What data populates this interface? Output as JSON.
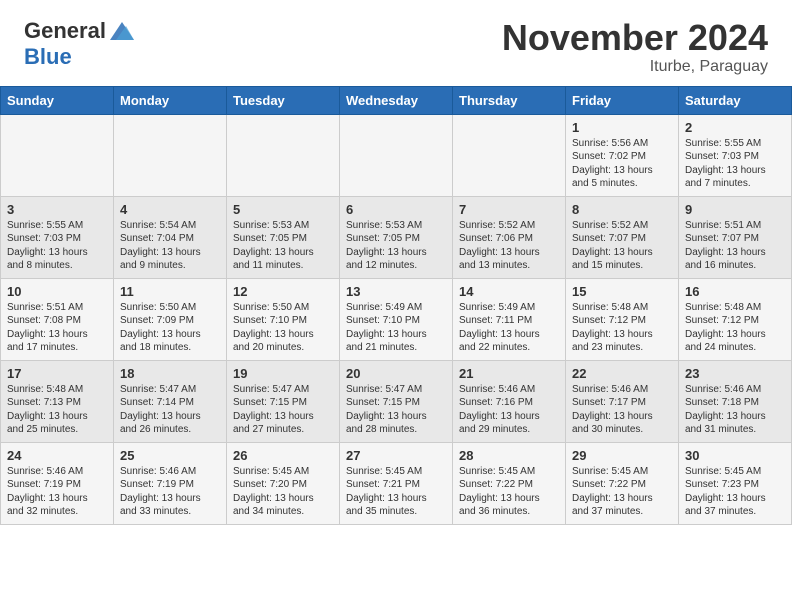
{
  "header": {
    "logo_general": "General",
    "logo_blue": "Blue",
    "month": "November 2024",
    "location": "Iturbe, Paraguay"
  },
  "weekdays": [
    "Sunday",
    "Monday",
    "Tuesday",
    "Wednesday",
    "Thursday",
    "Friday",
    "Saturday"
  ],
  "weeks": [
    [
      {
        "day": "",
        "info": ""
      },
      {
        "day": "",
        "info": ""
      },
      {
        "day": "",
        "info": ""
      },
      {
        "day": "",
        "info": ""
      },
      {
        "day": "",
        "info": ""
      },
      {
        "day": "1",
        "info": "Sunrise: 5:56 AM\nSunset: 7:02 PM\nDaylight: 13 hours and 5 minutes."
      },
      {
        "day": "2",
        "info": "Sunrise: 5:55 AM\nSunset: 7:03 PM\nDaylight: 13 hours and 7 minutes."
      }
    ],
    [
      {
        "day": "3",
        "info": "Sunrise: 5:55 AM\nSunset: 7:03 PM\nDaylight: 13 hours and 8 minutes."
      },
      {
        "day": "4",
        "info": "Sunrise: 5:54 AM\nSunset: 7:04 PM\nDaylight: 13 hours and 9 minutes."
      },
      {
        "day": "5",
        "info": "Sunrise: 5:53 AM\nSunset: 7:05 PM\nDaylight: 13 hours and 11 minutes."
      },
      {
        "day": "6",
        "info": "Sunrise: 5:53 AM\nSunset: 7:05 PM\nDaylight: 13 hours and 12 minutes."
      },
      {
        "day": "7",
        "info": "Sunrise: 5:52 AM\nSunset: 7:06 PM\nDaylight: 13 hours and 13 minutes."
      },
      {
        "day": "8",
        "info": "Sunrise: 5:52 AM\nSunset: 7:07 PM\nDaylight: 13 hours and 15 minutes."
      },
      {
        "day": "9",
        "info": "Sunrise: 5:51 AM\nSunset: 7:07 PM\nDaylight: 13 hours and 16 minutes."
      }
    ],
    [
      {
        "day": "10",
        "info": "Sunrise: 5:51 AM\nSunset: 7:08 PM\nDaylight: 13 hours and 17 minutes."
      },
      {
        "day": "11",
        "info": "Sunrise: 5:50 AM\nSunset: 7:09 PM\nDaylight: 13 hours and 18 minutes."
      },
      {
        "day": "12",
        "info": "Sunrise: 5:50 AM\nSunset: 7:10 PM\nDaylight: 13 hours and 20 minutes."
      },
      {
        "day": "13",
        "info": "Sunrise: 5:49 AM\nSunset: 7:10 PM\nDaylight: 13 hours and 21 minutes."
      },
      {
        "day": "14",
        "info": "Sunrise: 5:49 AM\nSunset: 7:11 PM\nDaylight: 13 hours and 22 minutes."
      },
      {
        "day": "15",
        "info": "Sunrise: 5:48 AM\nSunset: 7:12 PM\nDaylight: 13 hours and 23 minutes."
      },
      {
        "day": "16",
        "info": "Sunrise: 5:48 AM\nSunset: 7:12 PM\nDaylight: 13 hours and 24 minutes."
      }
    ],
    [
      {
        "day": "17",
        "info": "Sunrise: 5:48 AM\nSunset: 7:13 PM\nDaylight: 13 hours and 25 minutes."
      },
      {
        "day": "18",
        "info": "Sunrise: 5:47 AM\nSunset: 7:14 PM\nDaylight: 13 hours and 26 minutes."
      },
      {
        "day": "19",
        "info": "Sunrise: 5:47 AM\nSunset: 7:15 PM\nDaylight: 13 hours and 27 minutes."
      },
      {
        "day": "20",
        "info": "Sunrise: 5:47 AM\nSunset: 7:15 PM\nDaylight: 13 hours and 28 minutes."
      },
      {
        "day": "21",
        "info": "Sunrise: 5:46 AM\nSunset: 7:16 PM\nDaylight: 13 hours and 29 minutes."
      },
      {
        "day": "22",
        "info": "Sunrise: 5:46 AM\nSunset: 7:17 PM\nDaylight: 13 hours and 30 minutes."
      },
      {
        "day": "23",
        "info": "Sunrise: 5:46 AM\nSunset: 7:18 PM\nDaylight: 13 hours and 31 minutes."
      }
    ],
    [
      {
        "day": "24",
        "info": "Sunrise: 5:46 AM\nSunset: 7:19 PM\nDaylight: 13 hours and 32 minutes."
      },
      {
        "day": "25",
        "info": "Sunrise: 5:46 AM\nSunset: 7:19 PM\nDaylight: 13 hours and 33 minutes."
      },
      {
        "day": "26",
        "info": "Sunrise: 5:45 AM\nSunset: 7:20 PM\nDaylight: 13 hours and 34 minutes."
      },
      {
        "day": "27",
        "info": "Sunrise: 5:45 AM\nSunset: 7:21 PM\nDaylight: 13 hours and 35 minutes."
      },
      {
        "day": "28",
        "info": "Sunrise: 5:45 AM\nSunset: 7:22 PM\nDaylight: 13 hours and 36 minutes."
      },
      {
        "day": "29",
        "info": "Sunrise: 5:45 AM\nSunset: 7:22 PM\nDaylight: 13 hours and 37 minutes."
      },
      {
        "day": "30",
        "info": "Sunrise: 5:45 AM\nSunset: 7:23 PM\nDaylight: 13 hours and 37 minutes."
      }
    ]
  ]
}
